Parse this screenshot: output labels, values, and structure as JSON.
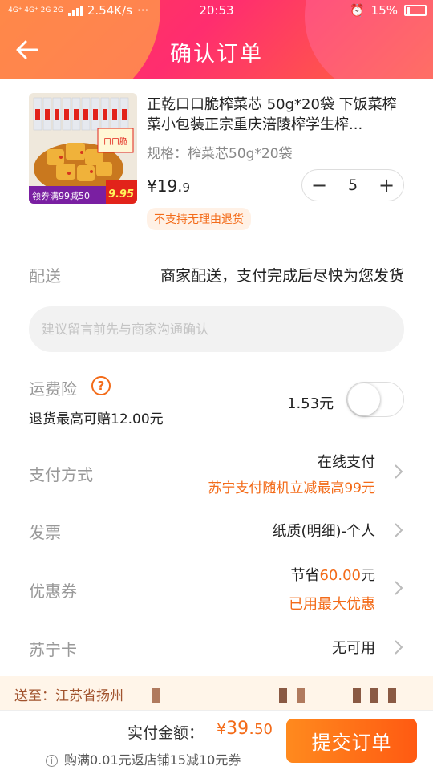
{
  "status_bar": {
    "network": "4G⁺ 4G⁺ 2G 2G",
    "speed": "2.54K/s",
    "more": "···",
    "time": "20:53",
    "battery": "15%"
  },
  "header": {
    "title": "确认订单"
  },
  "product": {
    "title": "正乾口口脆榨菜芯 50g*20袋 下饭菜榨菜小包装正宗重庆涪陵榨学生榨...",
    "spec": "规格：榨菜芯50g*20袋",
    "price_main": "¥19.",
    "price_decimal": "9",
    "quantity": "5",
    "minus": "−",
    "plus": "+",
    "return_note": "不支持无理由退货",
    "thumb_badge_left": "领券满99减50",
    "thumb_badge_right": "9.95",
    "thumb_label": "口口脆"
  },
  "delivery": {
    "label": "配送",
    "value": "商家配送，支付完成后尽快为您发货"
  },
  "message": {
    "placeholder": "建议留言前先与商家沟通确认"
  },
  "shipping_insurance": {
    "label": "运费险",
    "help": "?",
    "sub": "退货最高可赔12.00元",
    "price": "1.53元",
    "enabled": false
  },
  "payment": {
    "label": "支付方式",
    "value": "在线支付",
    "promo": "苏宁支付随机立减最高99元"
  },
  "invoice": {
    "label": "发票",
    "value": "纸质(明细)-个人"
  },
  "coupon": {
    "label": "优惠券",
    "save_prefix": "节省",
    "save_amount": "60.00",
    "save_suffix": "元",
    "note": "已用最大优惠"
  },
  "suning_card": {
    "label": "苏宁卡",
    "value": "无可用"
  },
  "address": {
    "text": "送至：江苏省扬州"
  },
  "footer": {
    "total_label": "实付金额：",
    "total_currency": "¥",
    "total_int": "39.",
    "total_dec": "50",
    "promo": "购满0.01元返店铺15减10元券",
    "submit": "提交订单"
  },
  "colors": {
    "accent": "#f36b19",
    "header_start": "#ff3b57",
    "header_end": "#ff6a3a",
    "submit": "#ff6a18"
  }
}
